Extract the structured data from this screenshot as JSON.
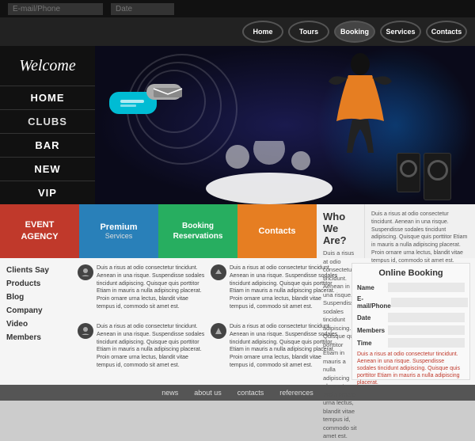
{
  "header": {
    "email_placeholder": "E-mail/Phone",
    "date_placeholder": "Date"
  },
  "top_nav": {
    "items": [
      "Home",
      "Tours",
      "Booking",
      "Services",
      "Contacts"
    ]
  },
  "logo": {
    "text": "Welcome"
  },
  "left_nav": {
    "items": [
      "HOME",
      "CLUBS",
      "BAR",
      "NEW",
      "VIP"
    ]
  },
  "color_section": {
    "event_agency": "EVENT\nAGENCY",
    "premium_label": "Premium",
    "premium_sub": "Services",
    "booking_label": "Booking",
    "reservations_label": "Reservations",
    "contacts_label": "Contacts",
    "who_title": "Who We Are?",
    "who_text": "Duis a risus at odio consectetur tincidunt. Aenean in una risque. Suspendisse sodales tincidunt adipiscing. Quisque quis porttitor Etiam in mauris a nulla adipiscing placerat. Proin ornare urna lectus, blandit vitae tempus id, commodo sit amet est.",
    "who_text_right": "Duis a risus at odio consectetur tincidunt. Aenean in una risque. Suspendisse sodales tincidunt adipiscing. Quisque quis porttitor Etiam in mauris a nulla adipiscing placerat. Proin ornare urna lectus, blandit vitae tempus id, commodo sit amet est."
  },
  "sidebar_links": {
    "items": [
      "Clients Say",
      "Products",
      "Blog",
      "Company",
      "Video",
      "Members"
    ]
  },
  "content_blocks": [
    {
      "text": "Duis a risus at odio consectetur tincidunt. Aenean in una risque. Suspendisse sodales tincidunt adipiscing. Quisque quis porttitor Etiam in mauris a nulla adipiscing placerat. Proin ornare urna lectus, blandit vitae tempus id, commodo sit amet est."
    },
    {
      "text": "Duis a risus at odio consectetur tincidunt. Aenean in una risque. Suspendisse sodales tincidunt adipiscing. Quisque quis porttitor Etiam in mauris a nulla adipiscing placerat. Proin ornare urna lectus, blandit vitae tempus id, commodo sit amet est."
    },
    {
      "text": "Duis a risus at odio consectetur tincidunt. Aenean in una risque. Suspendisse sodales tincidunt adipiscing. Quisque quis porttitor Etiam in mauris a nulla adipiscing placerat. Proin ornare urna lectus, blandit vitae tempus id, commodo sit amet est."
    },
    {
      "text": "Duis a risus at odio consectetur tincidunt. Aenean in una risque. Suspendisse sodales tincidunt adipiscing. Quisque quis porttitor Etiam in mauris a nulla adipiscing placerat. Proin ornare urna lectus, blandit vitae tempus id, commodo sit amet est."
    }
  ],
  "booking": {
    "title": "Online Booking",
    "fields": [
      "Name",
      "E-mail/Phone",
      "Date",
      "Members",
      "Time"
    ],
    "note": "Duis a risus at odio consectetur tincidunt. Aenean in una risque. Suspendisse sodales tincidunt adipiscing. Quisque quis porttitor Etiam in mauris a nulla adipiscing placerat."
  },
  "footer": {
    "links": [
      "news",
      "about us",
      "contacts",
      "references"
    ]
  }
}
